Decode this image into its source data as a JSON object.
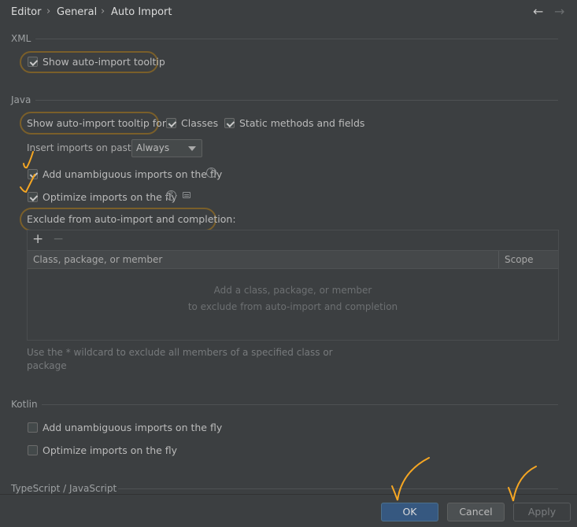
{
  "breadcrumb": {
    "items": [
      "Editor",
      "General",
      "Auto Import"
    ],
    "separator": "›"
  },
  "nav": {
    "back": "←",
    "forward": "→"
  },
  "xml": {
    "title": "XML",
    "show_tooltip": {
      "label": "Show auto-import tooltip",
      "checked": true
    }
  },
  "java": {
    "title": "Java",
    "show_tooltip_for_label": "Show auto-import tooltip for:",
    "classes": {
      "label": "Classes",
      "checked": true
    },
    "static_methods": {
      "label": "Static methods and fields",
      "checked": true
    },
    "insert_imports_label": "Insert imports on paste:",
    "insert_imports_value": "Always",
    "add_unambiguous": {
      "label": "Add unambiguous imports on the fly",
      "checked": true
    },
    "optimize_imports": {
      "label": "Optimize imports on the fly",
      "checked": true
    },
    "exclude_label": "Exclude from auto-import and completion:",
    "table": {
      "add_button": "+",
      "remove_button": "−",
      "columns": [
        "Class, package, or member",
        "Scope"
      ],
      "empty_line1": "Add a class, package, or member",
      "empty_line2": "to exclude from auto-import and completion"
    },
    "hint_line1": "Use the * wildcard to exclude all members of a specified class or",
    "hint_line2": "package"
  },
  "kotlin": {
    "title": "Kotlin",
    "add_unambiguous": {
      "label": "Add unambiguous imports on the fly",
      "checked": false
    },
    "optimize_imports": {
      "label": "Optimize imports on the fly",
      "checked": false
    }
  },
  "typescript": {
    "title": "TypeScript / JavaScript"
  },
  "footer": {
    "ok": "OK",
    "cancel": "Cancel",
    "apply": "Apply"
  },
  "colors": {
    "background": "#3c3f41",
    "primary_button": "#365880",
    "annotation_orange": "#f5a623",
    "highlight_oval": "#7a5f2a"
  }
}
